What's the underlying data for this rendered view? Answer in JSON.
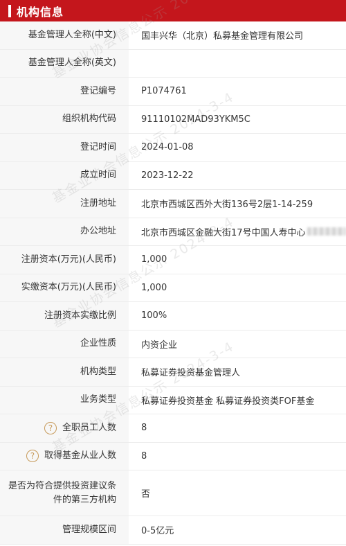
{
  "header": {
    "title": "机构信息"
  },
  "rows": [
    {
      "label": "基金管理人全称(中文)",
      "value": "国丰兴华（北京）私募基金管理有限公司"
    },
    {
      "label": "基金管理人全称(英文)",
      "value": ""
    },
    {
      "label": "登记编号",
      "value": "P1074761"
    },
    {
      "label": "组织机构代码",
      "value": "91110102MAD93YKM5C"
    },
    {
      "label": "登记时间",
      "value": "2024-01-08"
    },
    {
      "label": "成立时间",
      "value": "2023-12-22"
    },
    {
      "label": "注册地址",
      "value": "北京市西城区西外大街136号2层1-14-259"
    },
    {
      "label": "办公地址",
      "value": "北京市西城区金融大街17号中国人寿中心"
    },
    {
      "label": "注册资本(万元)(人民币)",
      "value": "1,000"
    },
    {
      "label": "实缴资本(万元)(人民币)",
      "value": "1,000"
    },
    {
      "label": "注册资本实缴比例",
      "value": "100%"
    },
    {
      "label": "企业性质",
      "value": "内资企业"
    },
    {
      "label": "机构类型",
      "value": "私募证券投资基金管理人"
    },
    {
      "label": "业务类型",
      "value": "私募证券投资基金  私募证券投资类FOF基金"
    },
    {
      "label": "全职员工人数",
      "value": "8",
      "icon": "?"
    },
    {
      "label": "取得基金从业人数",
      "value": "8",
      "icon": "?"
    },
    {
      "label": "是否为符合提供投资建议条件的第三方机构",
      "value": "否"
    },
    {
      "label": "管理规模区间",
      "value": "0-5亿元"
    }
  ],
  "watermark": "基金业协会信息公示 2024-3-4"
}
